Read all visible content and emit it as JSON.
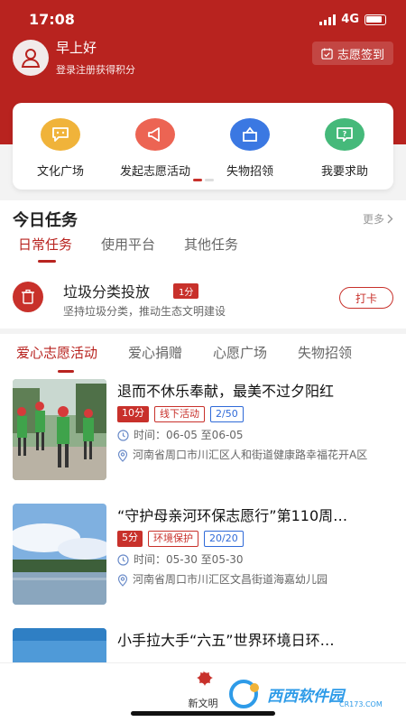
{
  "status_bar": {
    "time": "17:08",
    "network": "4G"
  },
  "header": {
    "greeting": "早上好",
    "subtext": "登录注册获得积分",
    "checkin_label": "志愿签到"
  },
  "quick_actions": [
    {
      "label": "文化广场",
      "icon": "chat-bubble-icon",
      "color": "#f0b33a"
    },
    {
      "label": "发起志愿活动",
      "icon": "megaphone-icon",
      "color": "#ec6453"
    },
    {
      "label": "失物招领",
      "icon": "box-icon",
      "color": "#3b78e2"
    },
    {
      "label": "我要求助",
      "icon": "help-icon",
      "color": "#45b97a"
    }
  ],
  "tasks": {
    "title": "今日任务",
    "more": "更多",
    "tabs": [
      "日常任务",
      "使用平台",
      "其他任务"
    ],
    "item": {
      "name": "垃圾分类投放",
      "badge": "1分",
      "desc": "坚持垃圾分类，推动生态文明建设",
      "action": "打卡"
    }
  },
  "activities": {
    "tabs": [
      "爱心志愿活动",
      "爱心捐赠",
      "心愿广场",
      "失物招领"
    ],
    "cards": [
      {
        "title": "退而不休乐奉献，最美不过夕阳红",
        "score": "10分",
        "type": "线下活动",
        "count": "2/50",
        "time": "时间：06-05 至06-05",
        "address": "河南省周口市川汇区人和街道健康路幸福花开A区"
      },
      {
        "title": "“守护母亲河环保志愿行”第110周…",
        "score": "5分",
        "type": "环境保护",
        "count": "20/20",
        "time": "时间：05-30 至05-30",
        "address": "河南省周口市川汇区文昌街道海嘉幼儿园"
      },
      {
        "title": "小手拉大手“六五”世界环境日环…"
      }
    ]
  },
  "tabbar": {
    "center_label": "新文明"
  },
  "watermark": {
    "text": "西西软件园",
    "sub": "CR173.COM"
  },
  "colors": {
    "brand": "#b8231f",
    "accent": "#c8312b",
    "blue": "#2f6ad8"
  }
}
